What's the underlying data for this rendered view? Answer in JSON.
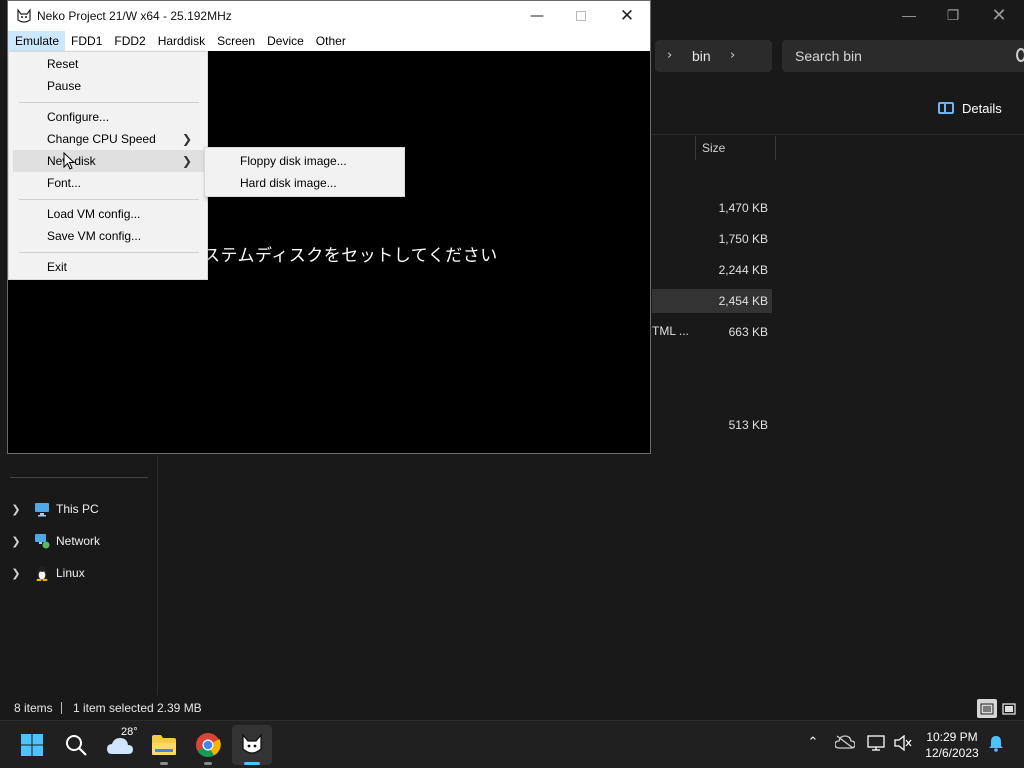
{
  "explorer": {
    "search_placeholder": "Search bin",
    "breadcrumb_current": "bin",
    "details_label": "Details",
    "column_size": "Size",
    "rows": [
      {
        "size": "1,470 KB",
        "type": ""
      },
      {
        "size": "1,750 KB",
        "type": ""
      },
      {
        "size": "2,244 KB",
        "type": ""
      },
      {
        "size": "2,454 KB",
        "type": ""
      },
      {
        "size": "663 KB",
        "type": "TML ..."
      },
      {
        "size": "513 KB",
        "type": ""
      }
    ],
    "nav": [
      {
        "label": "This PC",
        "icon": "computer-icon"
      },
      {
        "label": "Network",
        "icon": "network-icon"
      },
      {
        "label": "Linux",
        "icon": "linux-penguin-icon"
      }
    ],
    "status": {
      "items": "8 items",
      "selected": "1 item selected",
      "selected_size": "2.39 MB"
    }
  },
  "neko": {
    "title": "Neko Project 21/W x64 - 25.192MHz",
    "menubar": [
      "Emulate",
      "FDD1",
      "FDD2",
      "Harddisk",
      "Screen",
      "Device",
      "Other"
    ],
    "screen_message": "ステムディスクをセットしてください"
  },
  "emulate_menu": {
    "reset": "Reset",
    "pause": "Pause",
    "configure": "Configure...",
    "change_cpu_speed": "Change CPU Speed",
    "new_disk": "New disk",
    "font": "Font...",
    "load_vm": "Load VM config...",
    "save_vm": "Save VM config...",
    "exit": "Exit"
  },
  "new_disk_submenu": {
    "floppy": "Floppy disk image...",
    "hard": "Hard disk image..."
  },
  "taskbar": {
    "weather_temp": "28°",
    "time": "10:29 PM",
    "date": "12/6/2023"
  },
  "colors": {
    "accent": "#0078d4",
    "explorer_bg": "#191919",
    "taskbar_bg": "#202020",
    "menu_bg": "#f2f2f2"
  }
}
